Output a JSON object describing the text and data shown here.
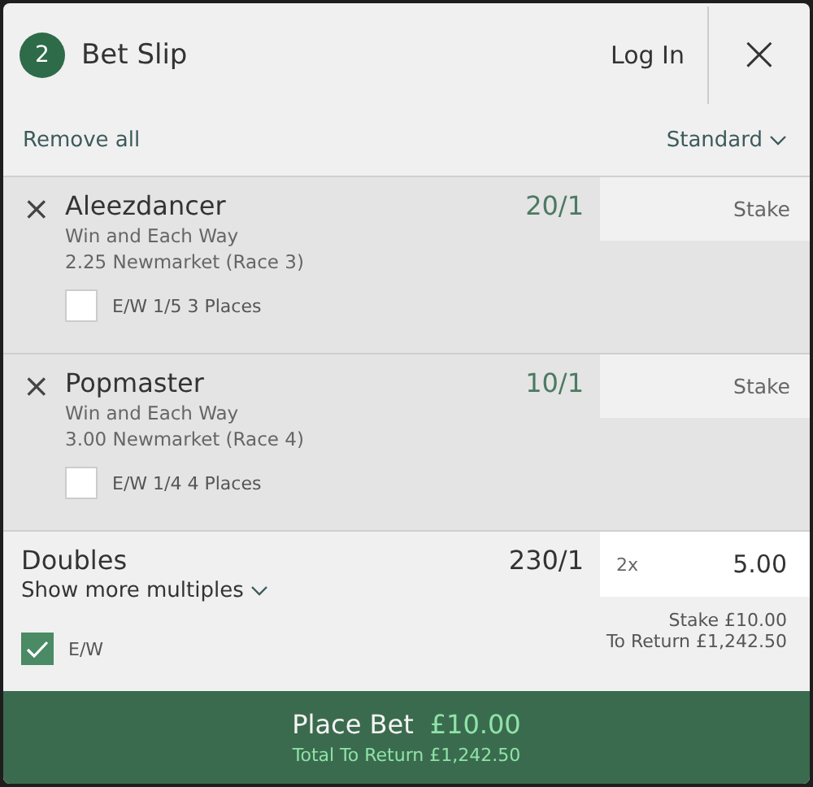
{
  "header": {
    "count": "2",
    "title": "Bet Slip",
    "login": "Log In",
    "close": "×"
  },
  "toolbar": {
    "remove_all": "Remove all",
    "mode": "Standard"
  },
  "selections": [
    {
      "remove": "×",
      "name": "Aleezdancer",
      "odds": "20/1",
      "market": "Win and Each Way",
      "event": "2.25 Newmarket (Race 3)",
      "each_way": "E/W 1/5 3 Places",
      "checked": false,
      "stake_placeholder": "Stake"
    },
    {
      "remove": "×",
      "name": "Popmaster",
      "odds": "10/1",
      "market": "Win and Each Way",
      "event": "3.00 Newmarket (Race 4)",
      "each_way": "E/W 1/4 4 Places",
      "checked": false,
      "stake_placeholder": "Stake"
    }
  ],
  "multiple": {
    "name": "Doubles",
    "odds": "230/1",
    "more": "Show more multiples",
    "multiplier": "2x",
    "stake": "5.00",
    "stake_total": "Stake £10.00",
    "to_return": "To Return £1,242.50",
    "each_way": "E/W",
    "checked": true
  },
  "place_bet": {
    "label": "Place Bet",
    "amount": "£10.00",
    "total": "Total To Return £1,242.50"
  }
}
